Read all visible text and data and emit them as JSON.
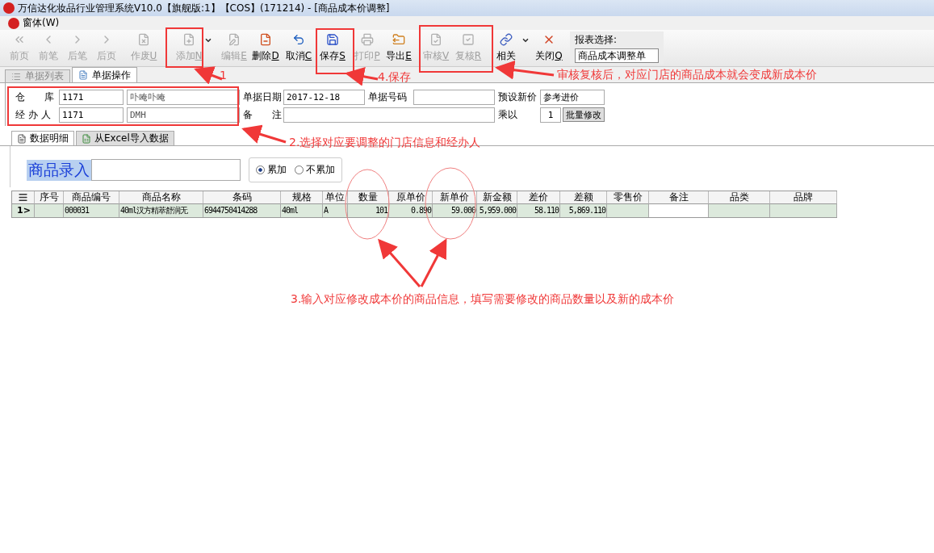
{
  "window": {
    "title": "万信达化妆品行业管理系统V10.0【旗舰版:1】【COS】(171214) - [商品成本价调整]"
  },
  "menu": [
    {
      "label": "窗体(W)"
    }
  ],
  "toolbar": [
    {
      "label": "前页",
      "disabled": true,
      "dropdown": false
    },
    {
      "label": "前笔",
      "disabled": true,
      "dropdown": false
    },
    {
      "label": "后笔",
      "disabled": true,
      "dropdown": false
    },
    {
      "label": "后页",
      "disabled": true,
      "dropdown": false
    },
    {
      "label": "作废",
      "key": "U",
      "disabled": true,
      "dropdown": false
    },
    {
      "label": "添加",
      "key": "N",
      "disabled": true,
      "dropdown": true
    },
    {
      "label": "编辑",
      "key": "E",
      "disabled": true,
      "dropdown": false
    },
    {
      "label": "删除",
      "key": "D",
      "disabled": false,
      "dropdown": false
    },
    {
      "label": "取消",
      "key": "C",
      "disabled": false,
      "dropdown": false
    },
    {
      "label": "保存",
      "key": "S",
      "disabled": false,
      "dropdown": false
    },
    {
      "label": "打印",
      "key": "P",
      "disabled": true,
      "dropdown": false
    },
    {
      "label": "导出",
      "key": "E",
      "disabled": false,
      "dropdown": false
    },
    {
      "label": "审核",
      "key": "V",
      "disabled": true,
      "dropdown": false
    },
    {
      "label": "复核",
      "key": "R",
      "disabled": true,
      "dropdown": false
    },
    {
      "label": "相关",
      "disabled": false,
      "dropdown": true
    },
    {
      "label": "关闭",
      "key": "Q",
      "disabled": false,
      "dropdown": false
    }
  ],
  "report_select": {
    "label": "报表选择:",
    "value": "商品成本调整单"
  },
  "tabs": [
    {
      "label": "单据列表",
      "selected": false
    },
    {
      "label": "单据操作",
      "selected": true
    }
  ],
  "form": {
    "warehouse": {
      "label": "仓　　库",
      "code": "1171",
      "name": "卟唵卟唵"
    },
    "handler": {
      "label": "经 办 人",
      "code": "1171",
      "name": "DMH"
    },
    "date": {
      "label": "单据日期",
      "value": "2017-12-18"
    },
    "number": {
      "label": "单据号码"
    },
    "preset_price": {
      "label": "预设新价",
      "value": "参考进价"
    },
    "remark": {
      "label": "备　　注"
    },
    "multiply": {
      "label": "乘以",
      "value": "1"
    },
    "batch_button": "批量修改"
  },
  "sub_tabs": [
    {
      "label": "数据明细",
      "selected": true
    },
    {
      "label": "从Excel导入数据",
      "selected": false
    }
  ],
  "entry": {
    "label": "商品录入",
    "options": [
      {
        "label": "累加",
        "selected": true
      },
      {
        "label": "不累加",
        "selected": false
      }
    ]
  },
  "table": {
    "columns": [
      "序号",
      "商品编号",
      "商品名称",
      "条码",
      "规格",
      "单位",
      "数量",
      "原单价",
      "新单价",
      "新金额",
      "差价",
      "差额",
      "零售价",
      "备注",
      "品类",
      "品牌"
    ],
    "rows": [
      {
        "marker": "1>",
        "selected": true,
        "cells": [
          "",
          "000031",
          "40ml汉方精萃舒润无",
          "6944750414288",
          "40ml",
          "A",
          "101",
          "0.890",
          "59.000",
          "5,959.000",
          "58.110",
          "5,869.110",
          "",
          "",
          "",
          ""
        ]
      }
    ]
  },
  "annotations": [
    "1",
    "4.保存",
    "审核复核后，对应门店的商品成本就会变成新成本价",
    "2.选择对应要调整的门店信息和经办人",
    "3.输入对应修改成本价的商品信息，填写需要修改的商品数量以及新的成本价"
  ]
}
